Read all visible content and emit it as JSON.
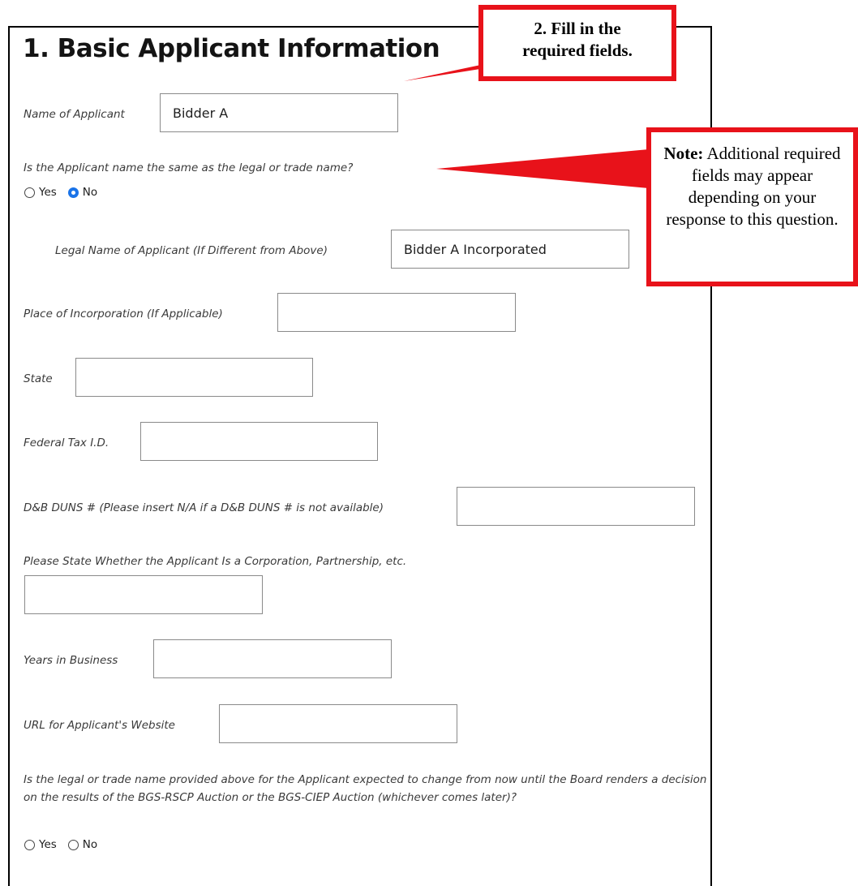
{
  "form": {
    "title": "1. Basic Applicant Information",
    "name_of_applicant": {
      "label": "Name of Applicant",
      "value": "Bidder A"
    },
    "same_name_question": {
      "label": "Is the Applicant name the same as the legal or trade name?",
      "options": [
        "Yes",
        "No"
      ],
      "selected": "No"
    },
    "legal_name": {
      "label": "Legal Name of Applicant (If Different from Above)",
      "value": "Bidder A Incorporated"
    },
    "place_of_incorporation": {
      "label": "Place of Incorporation (If Applicable)",
      "value": ""
    },
    "state": {
      "label": "State",
      "value": ""
    },
    "federal_tax_id": {
      "label": "Federal Tax I.D.",
      "value": ""
    },
    "duns": {
      "label": "D&B DUNS # (Please insert N/A if a D&B DUNS # is not available)",
      "value": ""
    },
    "entity_type": {
      "label": "Please State Whether the Applicant Is a Corporation, Partnership, etc.",
      "value": ""
    },
    "years_in_business": {
      "label": "Years in Business",
      "value": ""
    },
    "website_url": {
      "label": "URL for Applicant's Website",
      "value": ""
    },
    "name_change_question": {
      "label": "Is the legal or trade name provided above for the Applicant expected to change from now until the Board renders a decision on the results of the BGS-RSCP Auction or the BGS-CIEP Auction (whichever comes later)?",
      "options": [
        "Yes",
        "No"
      ],
      "selected": ""
    }
  },
  "callouts": {
    "fill_required": {
      "line1": "2. Fill in the",
      "line2": "required fields."
    },
    "note": {
      "bold": "Note:",
      "text": " Additional required fields may appear depending on your response to this question."
    }
  },
  "colors": {
    "callout_border": "#e8121a",
    "radio_selected": "#1a73e8"
  }
}
